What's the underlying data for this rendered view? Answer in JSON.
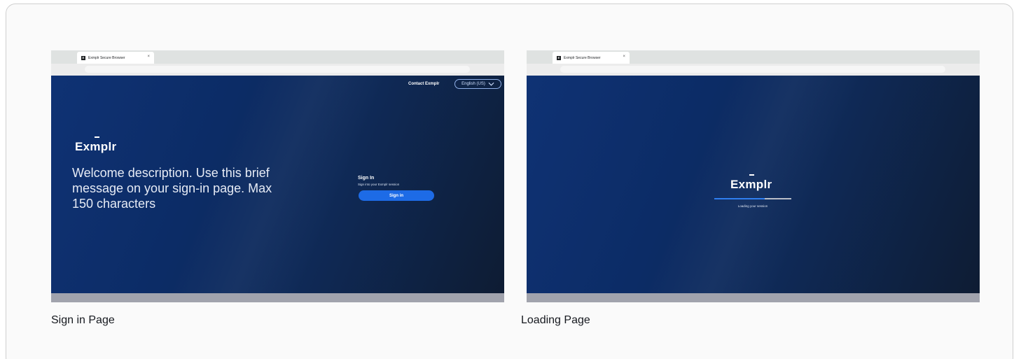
{
  "browser": {
    "tab_title": "Exmplr Secure Browser",
    "tab_favicon_letter": "E",
    "tab_close_glyph": "×"
  },
  "sign_in_page": {
    "contact_link": "Contact Exmplr",
    "language_selector": "English (US)",
    "logo_text": "Exmplr",
    "welcome_message": "Welcome description. Use this brief message on your sign-in page. Max 150 characters",
    "sign_in_title": "Sign In",
    "sign_in_subtitle": "Sign into your Exmplr session",
    "sign_in_button": "Sign in",
    "caption": "Sign in Page"
  },
  "loading_page": {
    "logo_text": "Exmplr",
    "loading_text": "Loading your session",
    "progress_fraction": 0.65,
    "caption": "Loading Page"
  },
  "icons": {
    "language_dropdown": "chevron-down-icon",
    "tab_favicon": "exmplr-favicon-icon",
    "tab_close": "close-icon"
  },
  "colors": {
    "brand_background": "#0c2c66",
    "button_blue": "#1d6be6",
    "progress_blue": "#2f7ef0",
    "bottom_bar": "#a1a3ad"
  }
}
